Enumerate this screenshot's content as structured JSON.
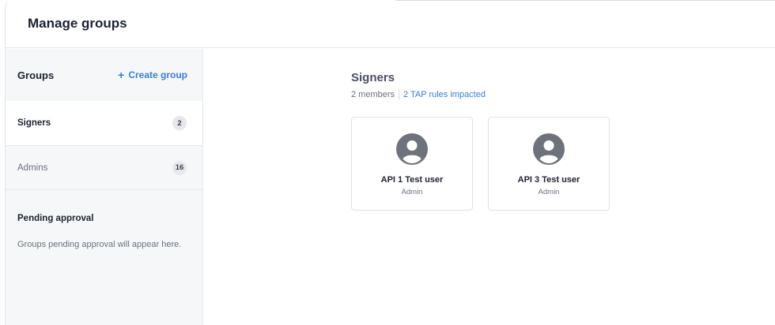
{
  "header": {
    "title": "Manage groups"
  },
  "sidebar": {
    "title": "Groups",
    "create_label": "Create group",
    "groups": [
      {
        "name": "Signers",
        "count": "2"
      },
      {
        "name": "Admins",
        "count": "16"
      }
    ],
    "pending": {
      "title": "Pending approval",
      "text": "Groups pending approval will appear here."
    }
  },
  "main": {
    "group_title": "Signers",
    "members": "2 members",
    "rules_link": "2 TAP rules impacted",
    "users": [
      {
        "name": "API 1 Test user",
        "role": "Admin"
      },
      {
        "name": "API 3 Test user",
        "role": "Admin"
      }
    ]
  },
  "colors": {
    "accent": "#3b7ddd",
    "avatar": "#6e727b"
  }
}
